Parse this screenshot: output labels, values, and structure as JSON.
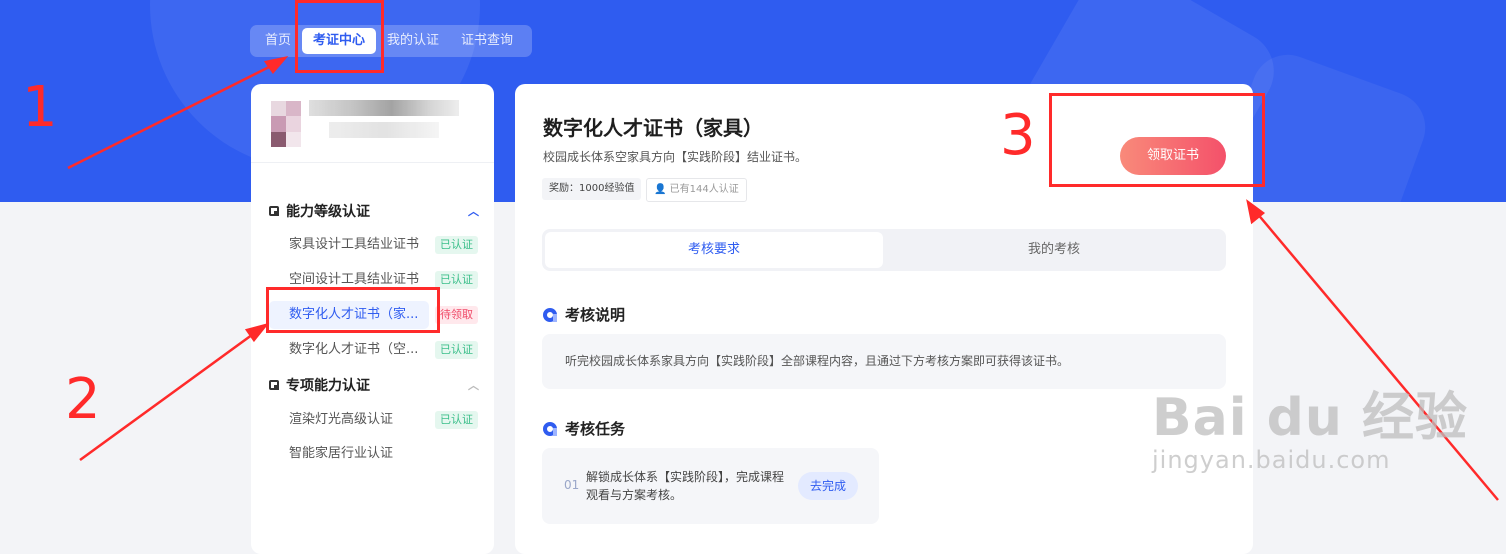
{
  "nav": {
    "tabs": [
      "首页",
      "考证中心",
      "我的认证",
      "证书查询"
    ],
    "active": "考证中心"
  },
  "sidebar": {
    "sections": [
      {
        "title": "能力等级认证",
        "items": [
          {
            "label": "家具设计工具结业证书",
            "status": "已认证"
          },
          {
            "label": "空间设计工具结业证书",
            "status": "已认证"
          },
          {
            "label": "数字化人才证书（家...",
            "status": "待领取"
          },
          {
            "label": "数字化人才证书（空...",
            "status": "已认证"
          }
        ]
      },
      {
        "title": "专项能力认证",
        "items": [
          {
            "label": "渲染灯光高级认证",
            "status": "已认证"
          },
          {
            "label": "智能家居行业认证",
            "status": ""
          }
        ]
      }
    ]
  },
  "main": {
    "title": "数字化人才证书（家具）",
    "subtitle": "校园成长体系空家具方向【实践阶段】结业证书。",
    "reward": "奖励：1000经验值",
    "certified_count": "已有144人认证",
    "claim_label": "领取证书",
    "tabs": [
      "考核要求",
      "我的考核"
    ],
    "desc_heading": "考核说明",
    "desc_text": "听完校园成长体系家具方向【实践阶段】全部课程内容，且通过下方考核方案即可获得该证书。",
    "task_heading": "考核任务",
    "task": {
      "num": "01",
      "text": "解锁成长体系【实践阶段】，完成课程观看与方案考核。",
      "action": "去完成"
    }
  },
  "annotations": {
    "n1": "1",
    "n2": "2",
    "n3": "3",
    "color": "#ff2a2a"
  },
  "watermark": {
    "big": "Bai du 经验",
    "small": "jingyan.baidu.com"
  },
  "colors": {
    "brand": "#2f5cf0",
    "claim_start": "#f98a7a",
    "claim_end": "#f4516a"
  }
}
